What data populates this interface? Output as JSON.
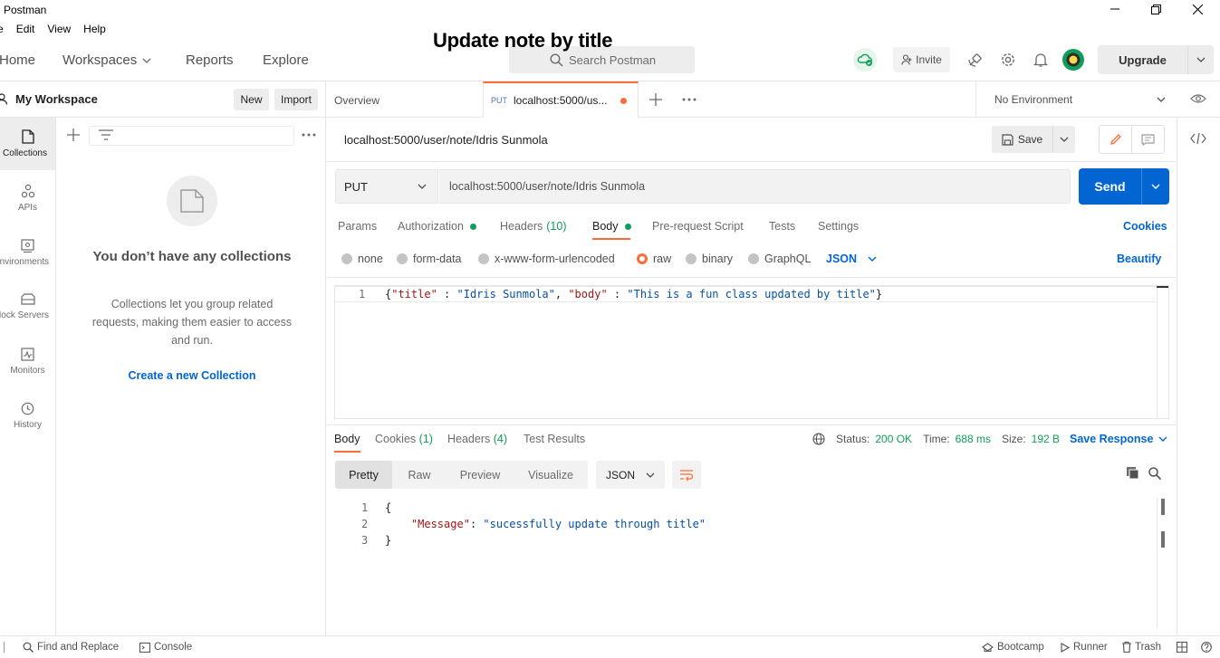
{
  "window": {
    "app_title": "Postman"
  },
  "menu": [
    "e",
    "Edit",
    "View",
    "Help"
  ],
  "header": {
    "nav": [
      "Home",
      "Workspaces",
      "Reports",
      "Explore"
    ],
    "overlay_title": "Update note by title",
    "search_placeholder": "Search Postman",
    "invite_label": "Invite",
    "upgrade_label": "Upgrade"
  },
  "sidebar": {
    "workspace_name": "My Workspace",
    "new_label": "New",
    "import_label": "Import",
    "items": [
      {
        "label": "Collections",
        "icon": "collections-icon"
      },
      {
        "label": "APIs",
        "icon": "apis-icon"
      },
      {
        "label": "Environments",
        "icon": "environments-icon"
      },
      {
        "label": "Mock Servers",
        "icon": "mock-servers-icon"
      },
      {
        "label": "Monitors",
        "icon": "monitors-icon"
      },
      {
        "label": "History",
        "icon": "history-icon"
      }
    ],
    "empty_title": "You don’t have any collections",
    "empty_desc": "Collections let you group related requests, making them easier to access and run.",
    "create_link": "Create a new Collection"
  },
  "tabs": {
    "overview": "Overview",
    "active_method": "PUT",
    "active_url": "localhost:5000/us...",
    "environment": "No Environment"
  },
  "request": {
    "name": "localhost:5000/user/note/Idris Sunmola",
    "save_label": "Save",
    "method": "PUT",
    "url": "localhost:5000/user/note/Idris Sunmola",
    "send_label": "Send",
    "tabs": {
      "params": "Params",
      "authorization": "Authorization",
      "headers": "Headers",
      "headers_count": "(10)",
      "body": "Body",
      "prerequest": "Pre-request Script",
      "tests": "Tests",
      "settings": "Settings"
    },
    "cookies_label": "Cookies",
    "body_modes": [
      "none",
      "form-data",
      "x-www-form-urlencoded",
      "raw",
      "binary",
      "GraphQL"
    ],
    "body_format": "JSON",
    "beautify_label": "Beautify",
    "body_line_number": "1",
    "body_json": {
      "k1": "\"title\"",
      "v1": "\"Idris Sunmola\"",
      "k2": "\"body\"",
      "v2": "\"This is a fun class updated by title\""
    }
  },
  "response": {
    "tabs": {
      "body": "Body",
      "cookies": "Cookies",
      "cookies_count": "(1)",
      "headers": "Headers",
      "headers_count": "(4)",
      "test_results": "Test Results"
    },
    "status_label": "Status:",
    "status_value": "200 OK",
    "time_label": "Time:",
    "time_value": "688 ms",
    "size_label": "Size:",
    "size_value": "192 B",
    "save_response": "Save Response",
    "formats": [
      "Pretty",
      "Raw",
      "Preview",
      "Visualize"
    ],
    "format_type": "JSON",
    "lines": [
      "1",
      "2",
      "3"
    ],
    "json_key": "\"Message\"",
    "json_value": "\"sucessfully update through title\""
  },
  "footer": {
    "find_replace": "Find and Replace",
    "console": "Console",
    "bootcamp": "Bootcamp",
    "runner": "Runner",
    "trash": "Trash"
  },
  "colors": {
    "accent": "#ff6c37",
    "primary": "#0265d2",
    "success": "#0f9d58"
  }
}
